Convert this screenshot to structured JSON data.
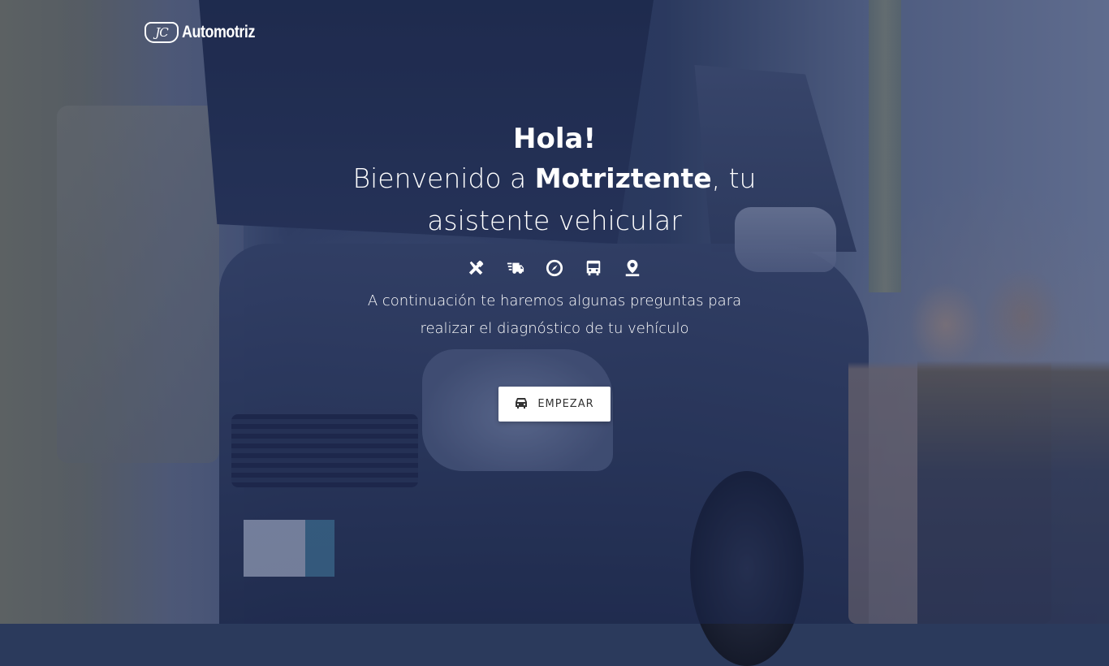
{
  "brand": {
    "logo_mark": "JC",
    "name": "Automotriz"
  },
  "hero": {
    "greeting": "Hola!",
    "title_prefix": "Bienvenido a ",
    "title_highlight": "Motriztente",
    "title_suffix": ", tu asistente vehicular",
    "description": "A continuación te haremos algunas preguntas para realizar el diagnóstico de tu vehículo"
  },
  "icons": [
    "tools-icon",
    "fast-truck-icon",
    "compass-icon",
    "bus-icon",
    "map-pin-icon"
  ],
  "start_button": {
    "label": "EMPEZAR",
    "icon": "car-icon"
  },
  "colors": {
    "overlay": "#1c2d5f",
    "button_bg": "#ffffff",
    "button_text": "#333333",
    "text": "#ffffff"
  }
}
